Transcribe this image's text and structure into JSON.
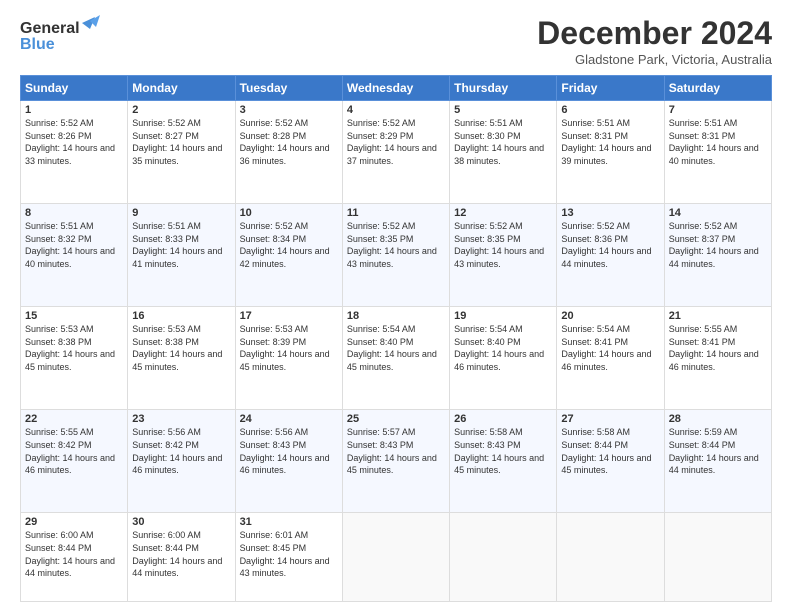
{
  "header": {
    "logo_line1": "General",
    "logo_line2": "Blue",
    "month_title": "December 2024",
    "location": "Gladstone Park, Victoria, Australia"
  },
  "days_of_week": [
    "Sunday",
    "Monday",
    "Tuesday",
    "Wednesday",
    "Thursday",
    "Friday",
    "Saturday"
  ],
  "weeks": [
    [
      {
        "day": "1",
        "sunrise": "5:52 AM",
        "sunset": "8:26 PM",
        "daylight": "14 hours and 33 minutes."
      },
      {
        "day": "2",
        "sunrise": "5:52 AM",
        "sunset": "8:27 PM",
        "daylight": "14 hours and 35 minutes."
      },
      {
        "day": "3",
        "sunrise": "5:52 AM",
        "sunset": "8:28 PM",
        "daylight": "14 hours and 36 minutes."
      },
      {
        "day": "4",
        "sunrise": "5:52 AM",
        "sunset": "8:29 PM",
        "daylight": "14 hours and 37 minutes."
      },
      {
        "day": "5",
        "sunrise": "5:51 AM",
        "sunset": "8:30 PM",
        "daylight": "14 hours and 38 minutes."
      },
      {
        "day": "6",
        "sunrise": "5:51 AM",
        "sunset": "8:31 PM",
        "daylight": "14 hours and 39 minutes."
      },
      {
        "day": "7",
        "sunrise": "5:51 AM",
        "sunset": "8:31 PM",
        "daylight": "14 hours and 40 minutes."
      }
    ],
    [
      {
        "day": "8",
        "sunrise": "5:51 AM",
        "sunset": "8:32 PM",
        "daylight": "14 hours and 40 minutes."
      },
      {
        "day": "9",
        "sunrise": "5:51 AM",
        "sunset": "8:33 PM",
        "daylight": "14 hours and 41 minutes."
      },
      {
        "day": "10",
        "sunrise": "5:52 AM",
        "sunset": "8:34 PM",
        "daylight": "14 hours and 42 minutes."
      },
      {
        "day": "11",
        "sunrise": "5:52 AM",
        "sunset": "8:35 PM",
        "daylight": "14 hours and 43 minutes."
      },
      {
        "day": "12",
        "sunrise": "5:52 AM",
        "sunset": "8:35 PM",
        "daylight": "14 hours and 43 minutes."
      },
      {
        "day": "13",
        "sunrise": "5:52 AM",
        "sunset": "8:36 PM",
        "daylight": "14 hours and 44 minutes."
      },
      {
        "day": "14",
        "sunrise": "5:52 AM",
        "sunset": "8:37 PM",
        "daylight": "14 hours and 44 minutes."
      }
    ],
    [
      {
        "day": "15",
        "sunrise": "5:53 AM",
        "sunset": "8:38 PM",
        "daylight": "14 hours and 45 minutes."
      },
      {
        "day": "16",
        "sunrise": "5:53 AM",
        "sunset": "8:38 PM",
        "daylight": "14 hours and 45 minutes."
      },
      {
        "day": "17",
        "sunrise": "5:53 AM",
        "sunset": "8:39 PM",
        "daylight": "14 hours and 45 minutes."
      },
      {
        "day": "18",
        "sunrise": "5:54 AM",
        "sunset": "8:40 PM",
        "daylight": "14 hours and 45 minutes."
      },
      {
        "day": "19",
        "sunrise": "5:54 AM",
        "sunset": "8:40 PM",
        "daylight": "14 hours and 46 minutes."
      },
      {
        "day": "20",
        "sunrise": "5:54 AM",
        "sunset": "8:41 PM",
        "daylight": "14 hours and 46 minutes."
      },
      {
        "day": "21",
        "sunrise": "5:55 AM",
        "sunset": "8:41 PM",
        "daylight": "14 hours and 46 minutes."
      }
    ],
    [
      {
        "day": "22",
        "sunrise": "5:55 AM",
        "sunset": "8:42 PM",
        "daylight": "14 hours and 46 minutes."
      },
      {
        "day": "23",
        "sunrise": "5:56 AM",
        "sunset": "8:42 PM",
        "daylight": "14 hours and 46 minutes."
      },
      {
        "day": "24",
        "sunrise": "5:56 AM",
        "sunset": "8:43 PM",
        "daylight": "14 hours and 46 minutes."
      },
      {
        "day": "25",
        "sunrise": "5:57 AM",
        "sunset": "8:43 PM",
        "daylight": "14 hours and 45 minutes."
      },
      {
        "day": "26",
        "sunrise": "5:58 AM",
        "sunset": "8:43 PM",
        "daylight": "14 hours and 45 minutes."
      },
      {
        "day": "27",
        "sunrise": "5:58 AM",
        "sunset": "8:44 PM",
        "daylight": "14 hours and 45 minutes."
      },
      {
        "day": "28",
        "sunrise": "5:59 AM",
        "sunset": "8:44 PM",
        "daylight": "14 hours and 44 minutes."
      }
    ],
    [
      {
        "day": "29",
        "sunrise": "6:00 AM",
        "sunset": "8:44 PM",
        "daylight": "14 hours and 44 minutes."
      },
      {
        "day": "30",
        "sunrise": "6:00 AM",
        "sunset": "8:44 PM",
        "daylight": "14 hours and 44 minutes."
      },
      {
        "day": "31",
        "sunrise": "6:01 AM",
        "sunset": "8:45 PM",
        "daylight": "14 hours and 43 minutes."
      },
      null,
      null,
      null,
      null
    ]
  ]
}
